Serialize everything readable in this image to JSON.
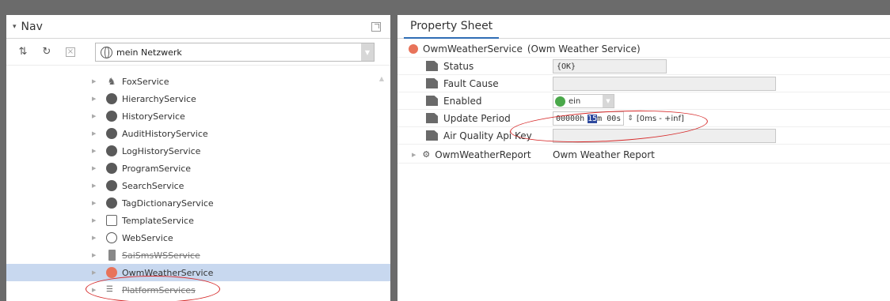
{
  "nav": {
    "title": "Nav",
    "network": "mein Netzwerk",
    "items": [
      {
        "label": "FoxService",
        "icon": "fox-icon"
      },
      {
        "label": "HierarchyService",
        "icon": "hierarchy-icon"
      },
      {
        "label": "HistoryService",
        "icon": "history-icon"
      },
      {
        "label": "AuditHistoryService",
        "icon": "audit-icon"
      },
      {
        "label": "LogHistoryService",
        "icon": "log-icon"
      },
      {
        "label": "ProgramService",
        "icon": "program-icon"
      },
      {
        "label": "SearchService",
        "icon": "search-icon"
      },
      {
        "label": "TagDictionaryService",
        "icon": "tag-icon"
      },
      {
        "label": "TemplateService",
        "icon": "template-icon"
      },
      {
        "label": "WebService",
        "icon": "globe-icon"
      },
      {
        "label": "SaiSmsWSService",
        "icon": "device-icon"
      },
      {
        "label": "OwmWeatherService",
        "icon": "weather-icon"
      },
      {
        "label": "PlatformServices",
        "icon": "platform-icon"
      }
    ]
  },
  "property_sheet": {
    "tab": "Property Sheet",
    "root_name": "OwmWeatherService",
    "root_type": "(Owm Weather Service)",
    "status_label": "Status",
    "status_value": "{OK}",
    "fault_label": "Fault Cause",
    "fault_value": "",
    "enabled_label": "Enabled",
    "enabled_value": "ein",
    "period_label": "Update Period",
    "period_hours": "00000h",
    "period_minutes": "15",
    "period_rest": "m 00s",
    "period_range": "[0ms - +inf]",
    "apikey_label": "Air Quality Api Key",
    "apikey_value": "",
    "report_name": "OwmWeatherReport",
    "report_type": "Owm Weather Report"
  },
  "colors": {
    "selection": "#c8d8ef",
    "tab_underline": "#2f6db5",
    "annotation": "#d62828",
    "enabled_green": "#4aa84a"
  }
}
